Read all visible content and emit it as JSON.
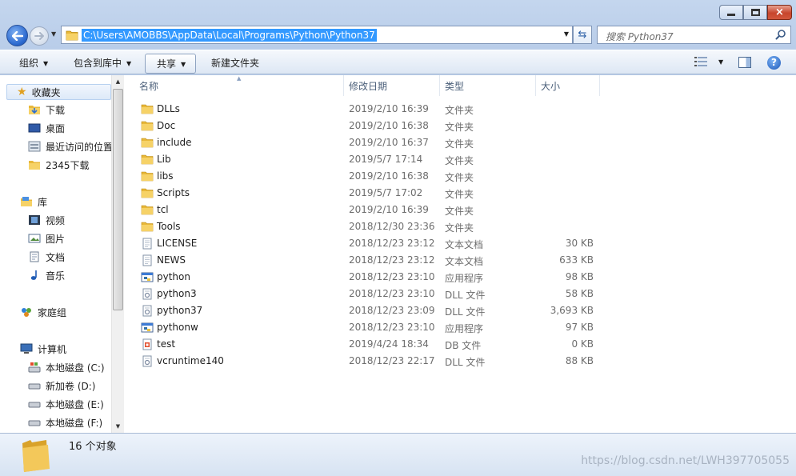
{
  "window": {
    "minimize_glyph": "minimize-icon",
    "maximize_glyph": "maximize-icon",
    "close_glyph": "×"
  },
  "address": {
    "path": "C:\\Users\\AMOBBS\\AppData\\Local\\Programs\\Python\\Python37",
    "search_placeholder": "搜索 Python37"
  },
  "toolbar": {
    "organize": "组织",
    "include_in_library": "包含到库中",
    "share": "共享",
    "new_folder": "新建文件夹"
  },
  "sidebar": {
    "favorites_header": "收藏夹",
    "favorites": [
      "下载",
      "桌面",
      "最近访问的位置",
      "2345下载"
    ],
    "libraries_header": "库",
    "libraries": [
      "视频",
      "图片",
      "文档",
      "音乐"
    ],
    "homegroup": "家庭组",
    "computer_header": "计算机",
    "drives": [
      "本地磁盘 (C:)",
      "新加卷 (D:)",
      "本地磁盘 (E:)",
      "本地磁盘 (F:)"
    ]
  },
  "columns": {
    "name": "名称",
    "modified": "修改日期",
    "type": "类型",
    "size": "大小"
  },
  "files": [
    {
      "name": "DLLs",
      "date": "2019/2/10 16:39",
      "type": "文件夹",
      "size": "",
      "icon": "folder-icon"
    },
    {
      "name": "Doc",
      "date": "2019/2/10 16:38",
      "type": "文件夹",
      "size": "",
      "icon": "folder-icon"
    },
    {
      "name": "include",
      "date": "2019/2/10 16:37",
      "type": "文件夹",
      "size": "",
      "icon": "folder-icon"
    },
    {
      "name": "Lib",
      "date": "2019/5/7 17:14",
      "type": "文件夹",
      "size": "",
      "icon": "folder-icon"
    },
    {
      "name": "libs",
      "date": "2019/2/10 16:38",
      "type": "文件夹",
      "size": "",
      "icon": "folder-icon"
    },
    {
      "name": "Scripts",
      "date": "2019/5/7 17:02",
      "type": "文件夹",
      "size": "",
      "icon": "folder-icon"
    },
    {
      "name": "tcl",
      "date": "2019/2/10 16:39",
      "type": "文件夹",
      "size": "",
      "icon": "folder-icon"
    },
    {
      "name": "Tools",
      "date": "2018/12/30 23:36",
      "type": "文件夹",
      "size": "",
      "icon": "folder-icon"
    },
    {
      "name": "LICENSE",
      "date": "2018/12/23 23:12",
      "type": "文本文档",
      "size": "30 KB",
      "icon": "text-file-icon"
    },
    {
      "name": "NEWS",
      "date": "2018/12/23 23:12",
      "type": "文本文档",
      "size": "633 KB",
      "icon": "text-file-icon"
    },
    {
      "name": "python",
      "date": "2018/12/23 23:10",
      "type": "应用程序",
      "size": "98 KB",
      "icon": "python-exe-icon"
    },
    {
      "name": "python3",
      "date": "2018/12/23 23:10",
      "type": "DLL 文件",
      "size": "58 KB",
      "icon": "dll-file-icon"
    },
    {
      "name": "python37",
      "date": "2018/12/23 23:09",
      "type": "DLL 文件",
      "size": "3,693 KB",
      "icon": "dll-file-icon"
    },
    {
      "name": "pythonw",
      "date": "2018/12/23 23:10",
      "type": "应用程序",
      "size": "97 KB",
      "icon": "pythonw-exe-icon"
    },
    {
      "name": "test",
      "date": "2019/4/24 18:34",
      "type": "DB 文件",
      "size": "0 KB",
      "icon": "db-file-icon"
    },
    {
      "name": "vcruntime140",
      "date": "2018/12/23 22:17",
      "type": "DLL 文件",
      "size": "88 KB",
      "icon": "dll-file-icon"
    }
  ],
  "status": {
    "item_count": "16 个对象",
    "watermark": "https://blog.csdn.net/LWH397705055"
  }
}
